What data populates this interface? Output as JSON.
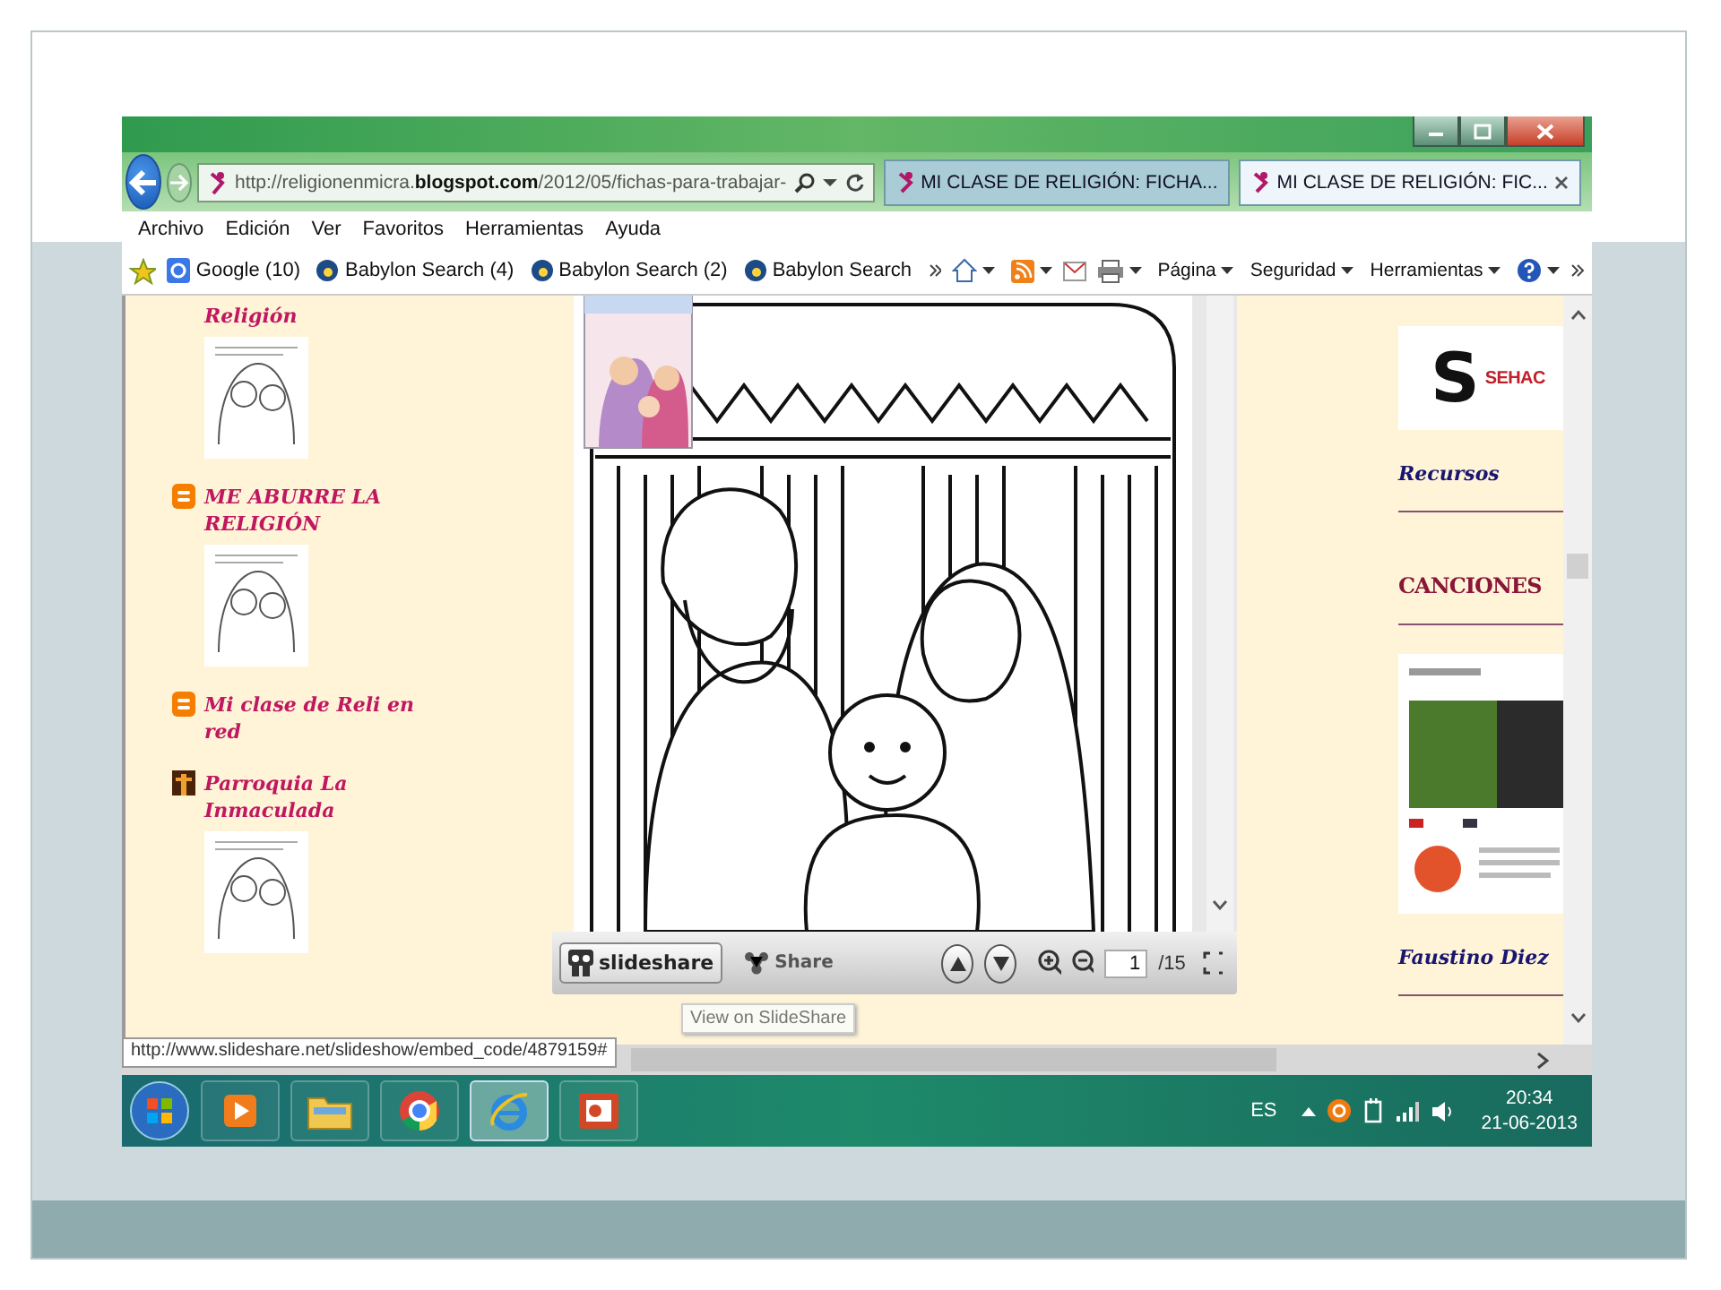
{
  "browser": {
    "address": "http://religionenmicra.**blogspot.com**/2012/05/fichas-para-trabajar-",
    "tabs": [
      {
        "label": "MI CLASE DE RELIGIÓN: FICHA...",
        "selected": false
      },
      {
        "label": "MI CLASE DE RELIGIÓN: FIC...",
        "selected": true
      }
    ],
    "menu": [
      "Archivo",
      "Edición",
      "Ver",
      "Favoritos",
      "Herramientas",
      "Ayuda"
    ],
    "favorites": [
      {
        "label": "Google (10)",
        "kind": "google"
      },
      {
        "label": "Babylon Search (4)",
        "kind": "babylon"
      },
      {
        "label": "Babylon Search (2)",
        "kind": "babylon"
      },
      {
        "label": "Babylon Search",
        "kind": "babylon"
      }
    ],
    "commands": [
      "Página",
      "Seguridad",
      "Herramientas"
    ]
  },
  "left_sidebar": {
    "items": [
      {
        "title": "Religión",
        "kind": "none",
        "thumbnail": true
      },
      {
        "title": "ME ABURRE LA RELIGIÓN",
        "kind": "blogger",
        "thumbnail": true
      },
      {
        "title": "Mi clase de Reli en red",
        "kind": "blogger",
        "thumbnail": false
      },
      {
        "title": "Parroquia La Inmaculada",
        "kind": "parish",
        "thumbnail": true
      }
    ]
  },
  "viewer": {
    "brand": "slideshare",
    "share": "Share",
    "page": "1",
    "total": "/15",
    "tooltip": "View on SlideShare"
  },
  "right_sidebar": {
    "items": [
      {
        "kind": "logo",
        "mark": "S",
        "text": "SEHAC"
      },
      {
        "kind": "link",
        "text": "Recursos"
      },
      {
        "kind": "heading",
        "text": "CANCIONES"
      },
      {
        "kind": "image"
      },
      {
        "kind": "link",
        "text": "Faustino Diez"
      }
    ]
  },
  "status_url": "http://www.slideshare.net/slideshow/embed_code/4879159#",
  "taskbar": {
    "apps": [
      {
        "kind": "media",
        "selected": false
      },
      {
        "kind": "folder",
        "selected": false
      },
      {
        "kind": "chrome",
        "selected": false
      },
      {
        "kind": "ie",
        "selected": true
      },
      {
        "kind": "powerpoint",
        "selected": false
      }
    ],
    "language": "ES",
    "time": "20:34",
    "date": "21-06-2013"
  }
}
